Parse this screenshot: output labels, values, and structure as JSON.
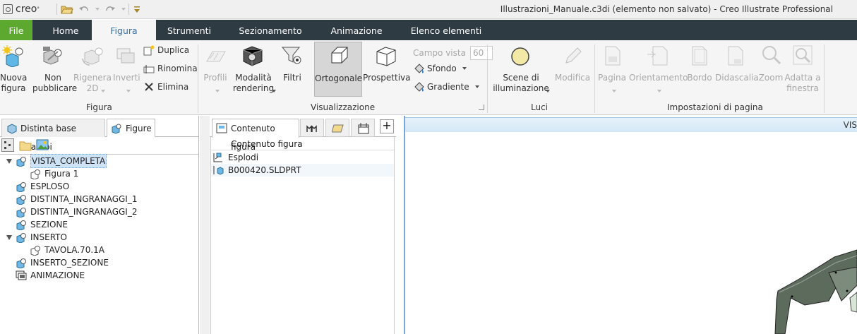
{
  "app": {
    "logo_text": "creo",
    "window_title": "Illustrazioni_Manuale.c3di (elemento non salvato) - Creo Illustrate Professional"
  },
  "tabs": [
    {
      "label": "File"
    },
    {
      "label": "Home"
    },
    {
      "label": "Figura"
    },
    {
      "label": "Strumenti"
    },
    {
      "label": "Sezionamento"
    },
    {
      "label": "Animazione"
    },
    {
      "label": "Elenco elementi"
    }
  ],
  "ribbon": {
    "figura": {
      "nuova_figura": "Nuova\nfigura",
      "non_pubblicare": "Non\npubblicare",
      "rigenera_2d": "Rigenera\n2D",
      "inverti": "Inverti",
      "duplica": "Duplica",
      "rinomina": "Rinomina",
      "elimina": "Elimina",
      "group_label": "Figura"
    },
    "visualizzazione": {
      "profili": "Profili",
      "modalita_rendering": "Modalità\nrendering",
      "filtri": "Filtri",
      "ortogonale": "Ortogonale",
      "prospettiva": "Prospettiva",
      "campo_vista_label": "Campo vista",
      "campo_vista_value": "60",
      "sfondo": "Sfondo",
      "gradiente": "Gradiente",
      "group_label": "Visualizzazione"
    },
    "luci": {
      "scene_illuminazione": "Scene di\nilluminazione",
      "modifica": "Modifica",
      "group_label": "Luci"
    },
    "impostazioni_pagina": {
      "pagina": "Pagina",
      "orientamento": "Orientamento",
      "bordo": "Bordo",
      "didascalia": "Didascalia",
      "zoom": "Zoom",
      "adatta_finestra": "Adatta a\nfinestra",
      "group_label": "Impostazioni di pagina"
    }
  },
  "left_panel": {
    "tabs": [
      {
        "label": "Distinta base ricambi"
      },
      {
        "label": "Figure"
      }
    ],
    "tree": [
      {
        "label": "VISTA_COMPLETA",
        "expanded": true,
        "selected": true
      },
      {
        "label": "Figura 1",
        "child": true
      },
      {
        "label": "ESPLOSO"
      },
      {
        "label": "DISTINTA_INGRANAGGI_1"
      },
      {
        "label": "DISTINTA_INGRANAGGI_2"
      },
      {
        "label": "SEZIONE"
      },
      {
        "label": "INSERTO",
        "expanded": true
      },
      {
        "label": "TAVOLA.70.1A",
        "child": true
      },
      {
        "label": "INSERTO_SEZIONE"
      },
      {
        "label": "ANIMAZIONE"
      }
    ]
  },
  "mid_panel": {
    "tab_label": "Contenuto figura",
    "column_header": "Contenuto figura",
    "rows": [
      {
        "label": "Esplodi"
      },
      {
        "label": "B000420.SLDPRT"
      }
    ]
  },
  "canvas": {
    "header_label": "VIS"
  },
  "colors": {
    "tabbar": "#2f3b43",
    "file_tab": "#5da82f",
    "active_tab_text": "#3d6fa3",
    "selection": "#cfe3f7",
    "model": "#5d6b5d"
  }
}
